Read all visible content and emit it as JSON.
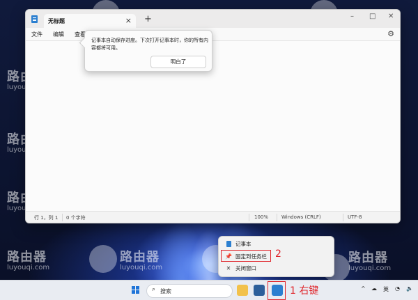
{
  "watermark": {
    "title": "路由器",
    "subtitle": "luyouqi.com"
  },
  "notepad": {
    "tab_title": "无标题",
    "tab_close": "×",
    "tab_add": "+",
    "window_controls": {
      "minimize": "–",
      "maximize": "□",
      "close": "✕"
    },
    "menus": [
      "文件",
      "编辑",
      "查看"
    ],
    "settings_glyph": "⚙",
    "status": {
      "position": "行 1，列 1",
      "chars": "0 个字符",
      "zoom": "100%",
      "line_ending": "Windows (CRLF)",
      "encoding": "UTF-8"
    }
  },
  "tooltip": {
    "text": "记事本自动保存进度。下次打开记事本时，你的所有内容都将可用。",
    "button": "明白了"
  },
  "context_menu": {
    "items": [
      {
        "label": "记事本",
        "icon": "notepad-icon"
      },
      {
        "label": "固定到任务栏",
        "icon": "pin-icon",
        "glyph": "📌"
      },
      {
        "label": "关闭窗口",
        "icon": "close-icon",
        "glyph": "✕"
      }
    ]
  },
  "annotations": {
    "step2": "2",
    "step1": "1 右键"
  },
  "taskbar": {
    "search_label": "搜索",
    "search_glyph": "⌕",
    "tray": {
      "chevron": "^",
      "ime": "英",
      "cloud_glyph": "☁",
      "wifi_glyph": "◔",
      "volume_glyph": "🔈"
    }
  },
  "colors": {
    "accent_red": "#e0242a",
    "windows_blue": "#1f74d8"
  }
}
